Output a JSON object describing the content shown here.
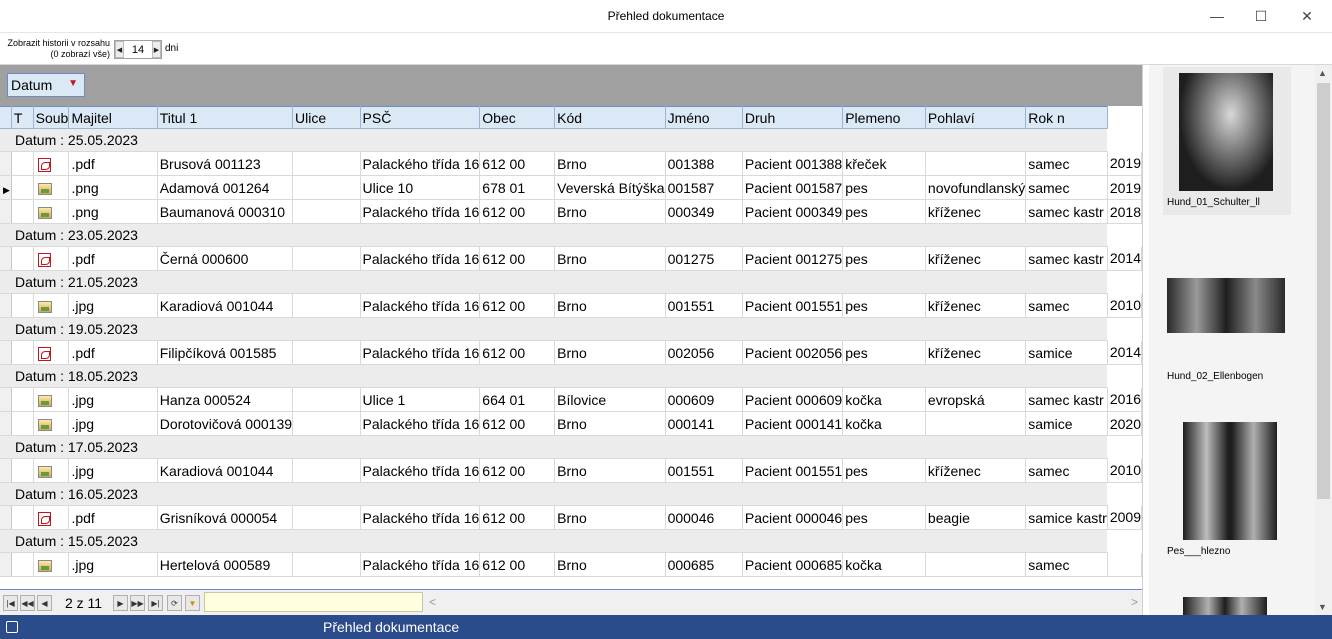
{
  "window": {
    "title": "Přehled dokumentace"
  },
  "toolbar": {
    "history_label_line1": "Zobrazit historii v rozsahu",
    "history_label_line2": "(0 zobrazí vše)",
    "days_value": "14",
    "days_unit": "dni"
  },
  "grouping": {
    "chip_label": "Datum"
  },
  "columns": [
    "T",
    "Soub",
    "Majitel",
    "Titul 1",
    "Ulice",
    "PSČ",
    "Obec",
    "Kód",
    "Jméno",
    "Druh",
    "Plemeno",
    "Pohlaví",
    "Rok n"
  ],
  "groups": [
    {
      "label": "Datum : 25.05.2023",
      "rows": [
        {
          "icon": "pdf-icon",
          "soub": ".pdf",
          "majitel": "Brusová 001123",
          "titul": "",
          "ulice": "Palackého třída 16",
          "psc": "612 00",
          "obec": "Brno",
          "kod": "001388",
          "jmeno": "Pacient 001388",
          "druh": "křeček",
          "plemeno": "",
          "pohlavi": "samec",
          "rok": "2019"
        },
        {
          "icon": "image-icon",
          "soub": ".png",
          "majitel": "Adamová 001264",
          "titul": "",
          "ulice": "Ulice 10",
          "psc": "678 01",
          "obec": "Veverská Bítýška",
          "kod": "001587",
          "jmeno": "Pacient 001587",
          "druh": "pes",
          "plemeno": "novofundlanský",
          "pohlavi": "samec",
          "rok": "2019",
          "current": true
        },
        {
          "icon": "image-icon",
          "soub": ".png",
          "majitel": "Baumanová 000310",
          "titul": "",
          "ulice": "Palackého třída 16",
          "psc": "612 00",
          "obec": "Brno",
          "kod": "000349",
          "jmeno": "Pacient 000349",
          "druh": "pes",
          "plemeno": "kříženec",
          "pohlavi": "samec kastr",
          "rok": "2018"
        }
      ]
    },
    {
      "label": "Datum : 23.05.2023",
      "rows": [
        {
          "icon": "pdf-icon",
          "soub": ".pdf",
          "majitel": "Černá 000600",
          "titul": "",
          "ulice": "Palackého třída 16",
          "psc": "612 00",
          "obec": "Brno",
          "kod": "001275",
          "jmeno": "Pacient 001275",
          "druh": "pes",
          "plemeno": "kříženec",
          "pohlavi": "samec kastr",
          "rok": "2014"
        }
      ]
    },
    {
      "label": "Datum : 21.05.2023",
      "rows": [
        {
          "icon": "image-icon",
          "soub": ".jpg",
          "majitel": "Karadiová 001044",
          "titul": "",
          "ulice": "Palackého třída 16",
          "psc": "612 00",
          "obec": "Brno",
          "kod": "001551",
          "jmeno": "Pacient 001551",
          "druh": "pes",
          "plemeno": "kříženec",
          "pohlavi": "samec",
          "rok": "2010"
        }
      ]
    },
    {
      "label": "Datum : 19.05.2023",
      "rows": [
        {
          "icon": "pdf-icon",
          "soub": ".pdf",
          "majitel": "Filipčíková 001585",
          "titul": "",
          "ulice": "Palackého třída 16",
          "psc": "612 00",
          "obec": "Brno",
          "kod": "002056",
          "jmeno": "Pacient 002056",
          "druh": "pes",
          "plemeno": "kříženec",
          "pohlavi": "samice",
          "rok": "2014"
        }
      ]
    },
    {
      "label": "Datum : 18.05.2023",
      "rows": [
        {
          "icon": "image-icon",
          "soub": ".jpg",
          "majitel": "Hanza 000524",
          "titul": "",
          "ulice": "Ulice 1",
          "psc": "664 01",
          "obec": "Bílovice",
          "kod": "000609",
          "jmeno": "Pacient 000609",
          "druh": "kočka",
          "plemeno": "evropská",
          "pohlavi": "samec kastr",
          "rok": "2016"
        },
        {
          "icon": "image-icon",
          "soub": ".jpg",
          "majitel": "Dorotovičová 000139",
          "titul": "",
          "ulice": "Palackého třída 16",
          "psc": "612 00",
          "obec": "Brno",
          "kod": "000141",
          "jmeno": "Pacient 000141",
          "druh": "kočka",
          "plemeno": "",
          "pohlavi": "samice",
          "rok": "2020"
        }
      ]
    },
    {
      "label": "Datum : 17.05.2023",
      "rows": [
        {
          "icon": "image-icon",
          "soub": ".jpg",
          "majitel": "Karadiová 001044",
          "titul": "",
          "ulice": "Palackého třída 16",
          "psc": "612 00",
          "obec": "Brno",
          "kod": "001551",
          "jmeno": "Pacient 001551",
          "druh": "pes",
          "plemeno": "kříženec",
          "pohlavi": "samec",
          "rok": "2010"
        }
      ]
    },
    {
      "label": "Datum : 16.05.2023",
      "rows": [
        {
          "icon": "pdf-icon",
          "soub": ".pdf",
          "majitel": "Grisníková 000054",
          "titul": "",
          "ulice": "Palackého třída 16",
          "psc": "612 00",
          "obec": "Brno",
          "kod": "000046",
          "jmeno": "Pacient 000046",
          "druh": "pes",
          "plemeno": "beagie",
          "pohlavi": "samice kastr",
          "rok": "2009"
        }
      ]
    },
    {
      "label": "Datum : 15.05.2023",
      "rows": [
        {
          "icon": "image-icon",
          "soub": ".jpg",
          "majitel": "Hertelová 000589",
          "titul": "",
          "ulice": "Palackého třída 16",
          "psc": "612 00",
          "obec": "Brno",
          "kod": "000685",
          "jmeno": "Pacient 000685",
          "druh": "kočka",
          "plemeno": "",
          "pohlavi": "samec",
          "rok": ""
        }
      ]
    }
  ],
  "navigator": {
    "page_text": "2 z 11"
  },
  "thumbnails": [
    {
      "label": "Hund_01_Schulter_ll"
    },
    {
      "label": "Hund_02_Ellenbogen"
    },
    {
      "label": "Pes___hlezno"
    }
  ],
  "statusbar": {
    "title": "Přehled dokumentace"
  },
  "colors": {
    "accent": "#2b4c8b",
    "header": "#dbe8f6",
    "group_row": "#ececec",
    "pdf": "#c0161c"
  }
}
